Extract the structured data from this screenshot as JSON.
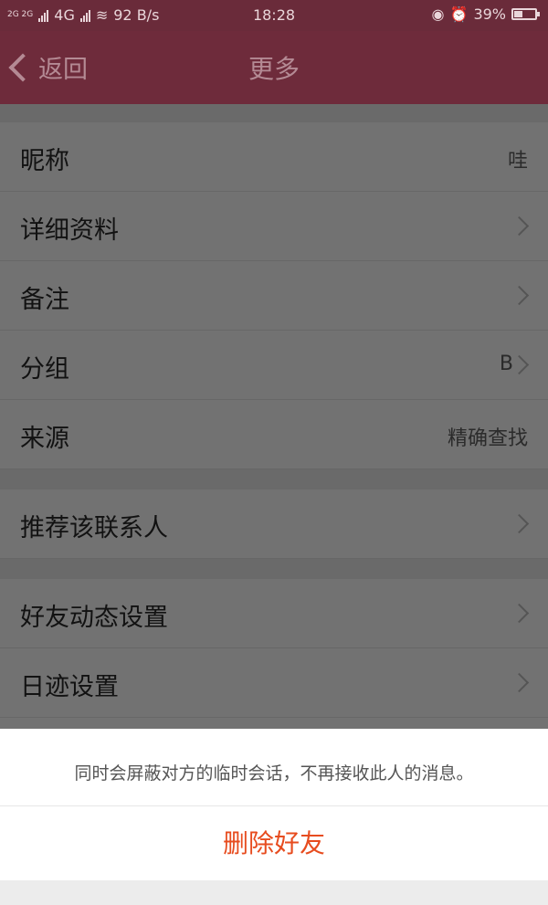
{
  "status_bar": {
    "network_small": "2G\n2G",
    "network_type": "4G",
    "speed": "92 B/s",
    "time": "18:28",
    "battery": "39%",
    "battery_level": 0.39
  },
  "nav": {
    "back_label": "返回",
    "title": "更多"
  },
  "group1": [
    {
      "label": "昵称",
      "value": "哇",
      "arrow": false
    },
    {
      "label": "详细资料",
      "value": "",
      "arrow": true
    },
    {
      "label": "备注",
      "value": "",
      "arrow": true
    },
    {
      "label": "分组",
      "value": "B",
      "arrow": true
    },
    {
      "label": "来源",
      "value": "精确查找",
      "arrow": false
    }
  ],
  "group2": [
    {
      "label": "推荐该联系人",
      "arrow": true
    }
  ],
  "group3": [
    {
      "label": "好友动态设置",
      "arrow": true
    },
    {
      "label": "日迹设置",
      "arrow": true
    }
  ],
  "sheet": {
    "note": "同时会屏蔽对方的临时会话，不再接收此人的消息。",
    "delete_label": "删除好友"
  },
  "colors": {
    "accent": "#6e2b3b",
    "danger": "#e74c1f"
  }
}
